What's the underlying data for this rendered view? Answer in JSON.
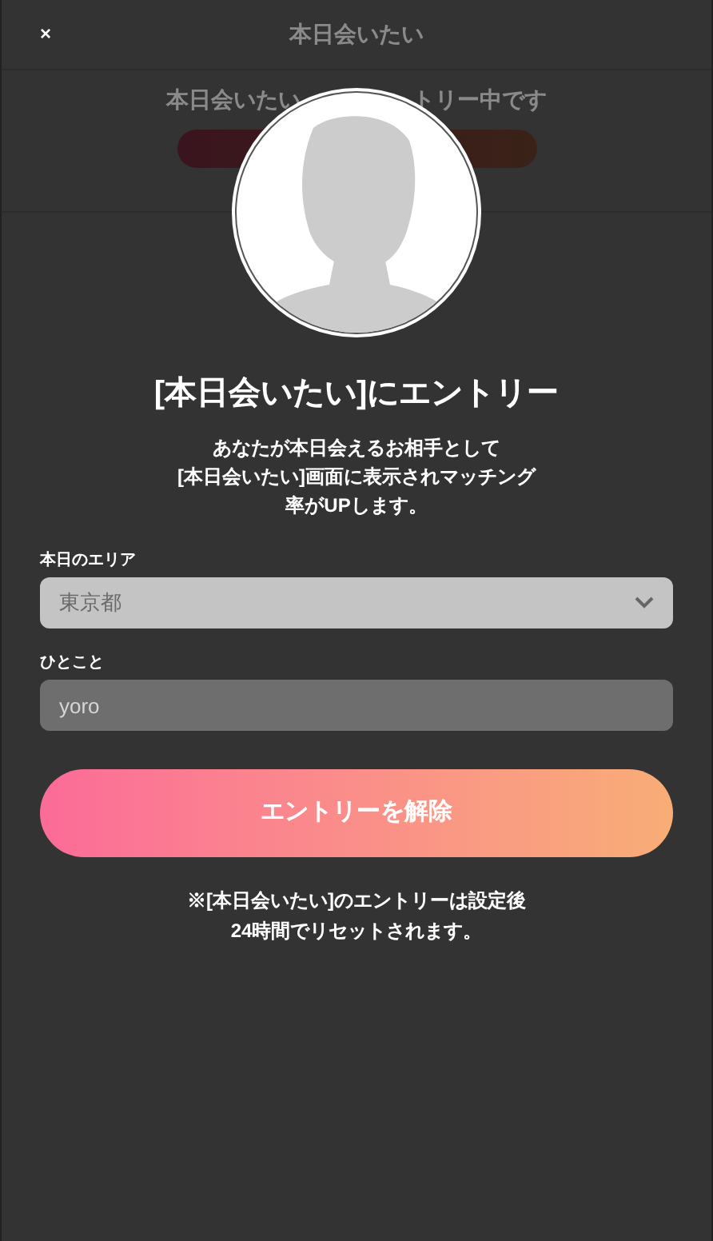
{
  "background": {
    "header": {
      "close": "×",
      "title": "本日会いたい"
    },
    "status_left": "本日会いたい",
    "status_right": "トリー中です"
  },
  "modal": {
    "title": "[本日会いたい]にエントリー",
    "description": [
      "あなたが本日会えるお相手として",
      "[本日会いたい]画面に表示されマッチング",
      "率がUPします。"
    ],
    "fields": [
      {
        "kind": "select",
        "label": "本日のエリア",
        "value": "東京都"
      },
      {
        "kind": "text",
        "label": "ひとこと",
        "value": "yoro"
      }
    ],
    "button": "エントリーを解除",
    "notes": [
      "※[本日会いたい]のエントリーは設定後",
      "24時間でリセットされます。"
    ]
  }
}
